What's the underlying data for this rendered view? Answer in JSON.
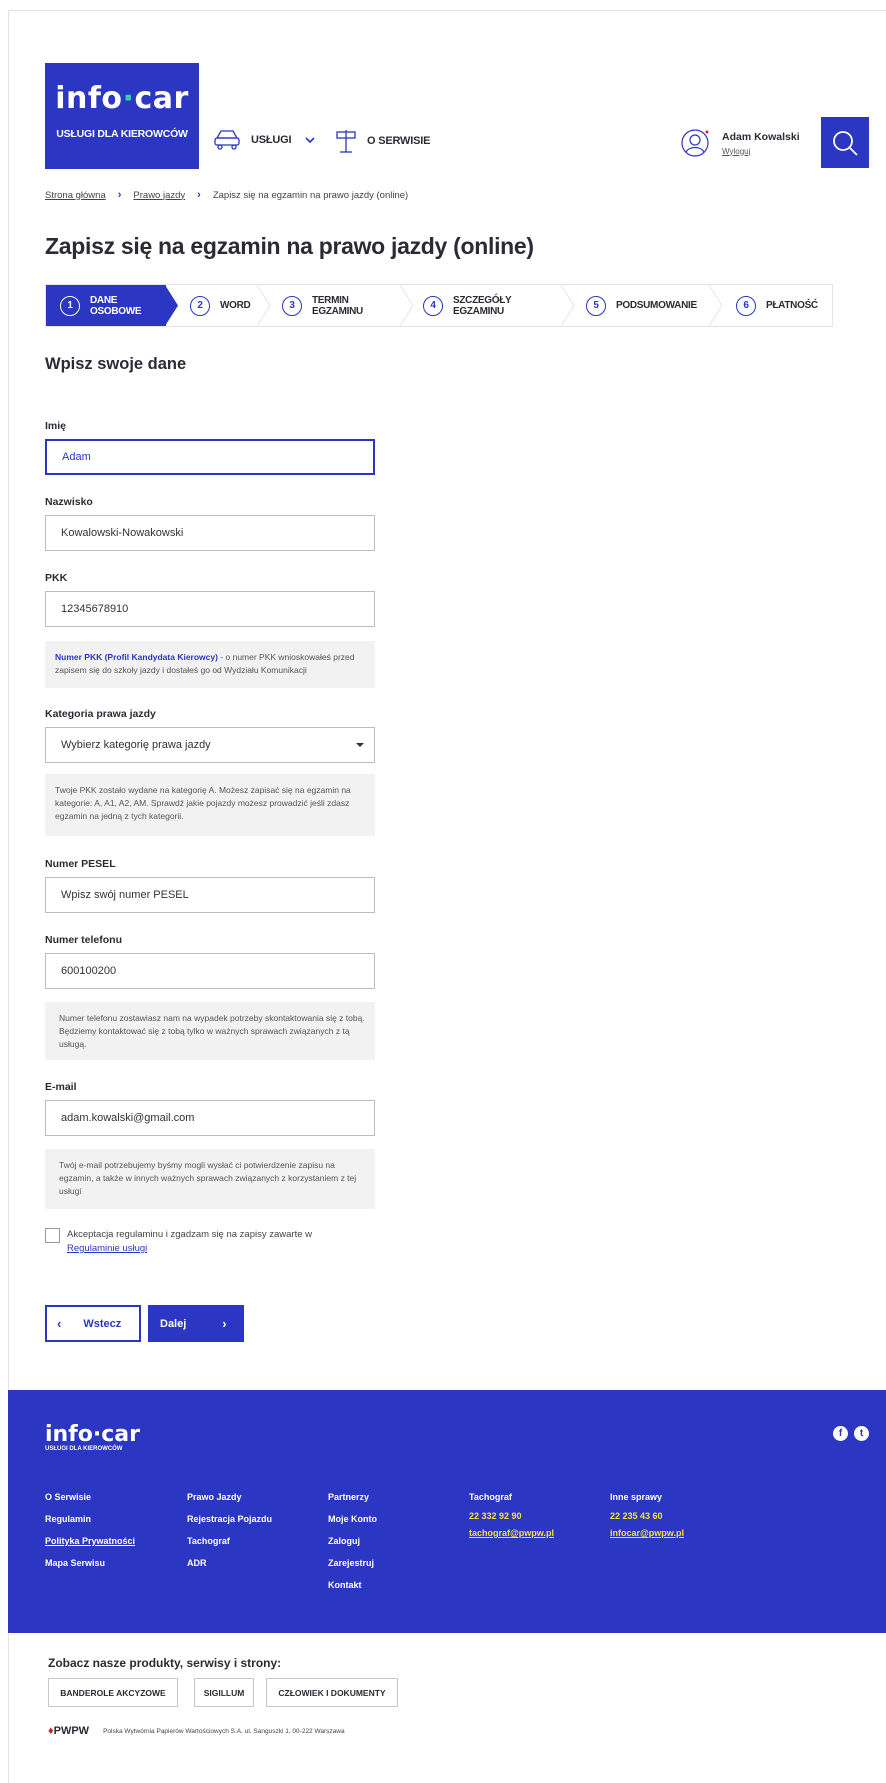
{
  "header": {
    "logo_word_a": "info",
    "logo_word_b": "car",
    "logo_sub": "USŁUGI DLA KIEROWCÓW",
    "nav_services": "USŁUGI",
    "nav_about": "O SERWISIE",
    "user_name": "Adam Kowalski",
    "logout": "Wyloguj"
  },
  "breadcrumb": [
    "Strona główna",
    "Prawo jazdy",
    "Zapisz się na egzamin na prawo jazdy (online)"
  ],
  "page_title": "Zapisz się na egzamin na prawo jazdy (online)",
  "steps": [
    {
      "num": "1",
      "label": "DANE OSOBOWE"
    },
    {
      "num": "2",
      "label": "WORD"
    },
    {
      "num": "3",
      "label": "TERMIN EGZAMINU"
    },
    {
      "num": "4",
      "label": "SZCZEGÓŁY EGZAMINU"
    },
    {
      "num": "5",
      "label": "PODSUMOWANIE"
    },
    {
      "num": "6",
      "label": "PŁATNOŚĆ"
    }
  ],
  "section_title": "Wpisz swoje dane",
  "form": {
    "first_name_label": "Imię",
    "first_name_value": "Adam",
    "last_name_label": "Nazwisko",
    "last_name_value": "Kowalowski-Nowakowski",
    "pkk_label": "PKK",
    "pkk_value": "12345678910",
    "pkk_hint_bold": "Numer PKK (Profil Kandydata Kierowcy)",
    "pkk_hint_rest": " - o numer PKK wnioskowałeś przed zapisem się do szkoły jazdy i dostałeś go od Wydziału Komunikacji",
    "category_label": "Kategoria prawa jazdy",
    "category_value": "Wybierz kategorię prawa jazdy",
    "category_hint": "Twoje PKK zostało wydane na kategorię A. Możesz zapisać się na egzamin na kategorie: A, A1, A2, AM. Sprawdź jakie pojazdy możesz prowadzić jeśli zdasz egzamin na jedną z tych kategorii.",
    "pesel_label": "Numer PESEL",
    "pesel_placeholder": "Wpisz swój numer PESEL",
    "phone_label": "Numer telefonu",
    "phone_value": "600100200",
    "phone_hint": "Numer telefonu zostawiasz nam na wypadek potrzeby skontaktowania się z tobą. Będziemy kontaktować się z tobą tylko w ważnych sprawach związanych z tą usługą.",
    "email_label": "E-mail",
    "email_value": "adam.kowalski@gmail.com",
    "email_hint": "Twój e-mail potrzebujemy byśmy mogli wysłać ci potwierdzenie zapisu na egzamin, a także w innych ważnych sprawach związanych z korzystaniem z tej usługi",
    "terms_text": "Akceptacja regulaminu i zgadzam się na zapisy zawarte w ",
    "terms_link": "Regulaminie usługi",
    "back_label": "Wstecz",
    "next_label": "Dalej"
  },
  "footer": {
    "logo_a": "info",
    "logo_b": "car",
    "logo_sub": "USŁUGI DLA KIEROWCÓW",
    "col1": [
      "O Serwisie",
      "Regulamin",
      "Polityka Prywatności",
      "Mapa Serwisu"
    ],
    "col2": [
      "Prawo Jazdy",
      "Rejestracja Pojazdu",
      "Tachograf",
      "ADR"
    ],
    "col3": [
      "Partnerzy",
      "Moje Konto",
      "Zaloguj",
      "Zarejestruj",
      "Kontakt"
    ],
    "col4_title": "Tachograf",
    "col4_phone": "22 332 92 90",
    "col4_email": "tachograf@pwpw.pl",
    "col5_title": "Inne sprawy",
    "col5_phone": "22 235 43 60",
    "col5_email": "infocar@pwpw.pl"
  },
  "products": {
    "title": "Zobacz nasze produkty, serwisy i strony:",
    "buttons": [
      "BANDEROLE AKCYZOWE",
      "SIGILLUM",
      "CZŁOWIEK I DOKUMENTY"
    ],
    "pwpw_logo": "PWPW",
    "pwpw_text": "Polska Wytwórnia Papierów Wartościowych S.A. ul. Sanguszki 1, 00-222 Warszawa"
  },
  "colors": {
    "primary": "#2b36c2",
    "accent_yellow": "#f5e33a",
    "logo_dot": "#2fd4a6"
  }
}
